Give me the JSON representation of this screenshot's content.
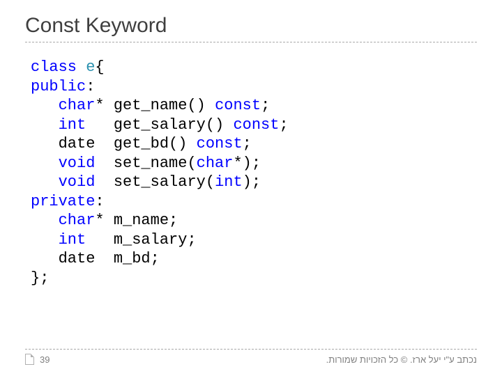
{
  "title": "Const Keyword",
  "code": {
    "l1": {
      "kw1": "class",
      "cls": "e",
      "rest": "{"
    },
    "l2": {
      "kw1": "public",
      "rest": ":"
    },
    "l3": {
      "type": "char",
      "rest1": "* get_name() ",
      "kw": "const",
      "rest2": ";"
    },
    "l4": {
      "type": "int",
      "rest1": "   get_salary() ",
      "kw": "const",
      "rest2": ";"
    },
    "l5": {
      "type": "date",
      "rest1": "  get_bd() ",
      "kw": "const",
      "rest2": ";"
    },
    "l6": {
      "type": "void",
      "rest1": "  set_name(",
      "argtype": "char",
      "rest2": "*);"
    },
    "l7": {
      "type": "void",
      "rest1": "  set_salary(",
      "argtype": "int",
      "rest2": ");"
    },
    "l8": {
      "kw1": "private",
      "rest": ":"
    },
    "l9": {
      "type": "char",
      "rest": "* m_name;"
    },
    "l10": {
      "type": "int",
      "rest": "   m_salary;"
    },
    "l11": {
      "type": "date",
      "rest": "  m_bd;"
    },
    "l12": {
      "rest": "};"
    }
  },
  "footer": {
    "page": "39",
    "credit": "נכתב ע\"י יעל ארז. © כל הזכויות שמורות."
  }
}
